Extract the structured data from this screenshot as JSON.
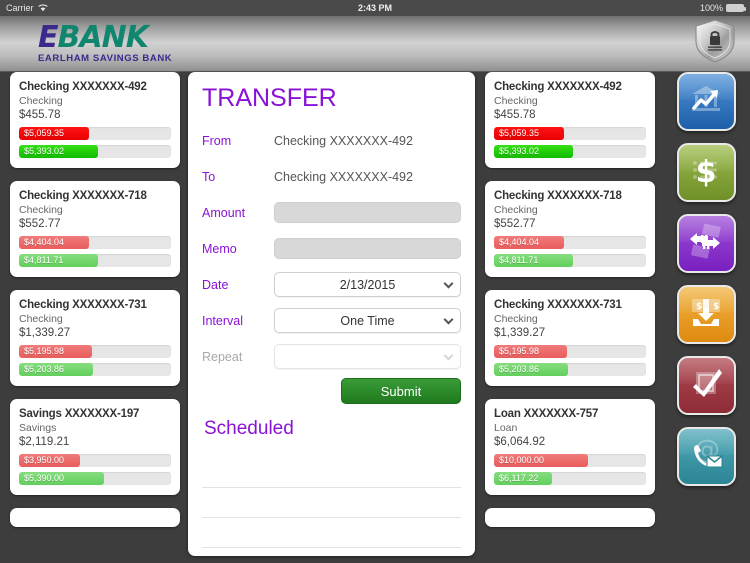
{
  "status_bar": {
    "carrier": "Carrier",
    "time": "2:43 PM",
    "battery": "100%",
    "wifi_icon": "wifi-icon",
    "battery_icon": "battery-icon"
  },
  "header": {
    "logo_e": "E",
    "logo_bank": "BANK",
    "logo_sub": "EARLHAM SAVINGS BANK",
    "shield_icon": "shield-lock-icon"
  },
  "colors": {
    "purple": "#8a12d6",
    "logo_indigo": "#3b2a8c",
    "logo_teal": "#11866f",
    "submit_green": "#1f7a1d",
    "bar_red": "#e85c5c",
    "bar_green": "#63cf5c",
    "bar_red_active": "#e80000",
    "bar_green_active": "#12bb00",
    "bar_track": "#e6e6e6"
  },
  "accounts_left": [
    {
      "title": "Checking XXXXXXX-492",
      "type": "Checking",
      "balance": "$455.78",
      "selected": true,
      "bars": [
        {
          "label": "$5,059.35",
          "color": "red",
          "pct": 46
        },
        {
          "label": "$5,393.02",
          "color": "green",
          "pct": 52
        }
      ]
    },
    {
      "title": "Checking XXXXXXX-718",
      "type": "Checking",
      "balance": "$552.77",
      "selected": false,
      "bars": [
        {
          "label": "$4,404.04",
          "color": "red",
          "pct": 46
        },
        {
          "label": "$4,811.71",
          "color": "green",
          "pct": 52
        }
      ]
    },
    {
      "title": "Checking XXXXXXX-731",
      "type": "Checking",
      "balance": "$1,339.27",
      "selected": false,
      "bars": [
        {
          "label": "$5,195.98",
          "color": "red",
          "pct": 48
        },
        {
          "label": "$5,203.86",
          "color": "green",
          "pct": 49
        }
      ]
    },
    {
      "title": "Savings XXXXXXX-197",
      "type": "Savings",
      "balance": "$2,119.21",
      "selected": false,
      "bars": [
        {
          "label": "$3,950.00",
          "color": "red",
          "pct": 40
        },
        {
          "label": "$5,390.00",
          "color": "green",
          "pct": 56
        }
      ]
    }
  ],
  "accounts_right": [
    {
      "title": "Checking XXXXXXX-492",
      "type": "Checking",
      "balance": "$455.78",
      "selected": true,
      "bars": [
        {
          "label": "$5,059.35",
          "color": "red",
          "pct": 46
        },
        {
          "label": "$5,393.02",
          "color": "green",
          "pct": 52
        }
      ]
    },
    {
      "title": "Checking XXXXXXX-718",
      "type": "Checking",
      "balance": "$552.77",
      "selected": false,
      "bars": [
        {
          "label": "$4,404.04",
          "color": "red",
          "pct": 46
        },
        {
          "label": "$4,811.71",
          "color": "green",
          "pct": 52
        }
      ]
    },
    {
      "title": "Checking XXXXXXX-731",
      "type": "Checking",
      "balance": "$1,339.27",
      "selected": false,
      "bars": [
        {
          "label": "$5,195.98",
          "color": "red",
          "pct": 48
        },
        {
          "label": "$5,203.86",
          "color": "green",
          "pct": 49
        }
      ]
    },
    {
      "title": "Loan XXXXXXX-757",
      "type": "Loan",
      "balance": "$6,064.92",
      "selected": false,
      "bars": [
        {
          "label": "$10,000.00",
          "color": "red",
          "pct": 62
        },
        {
          "label": "$6,117.22",
          "color": "green",
          "pct": 38
        }
      ]
    }
  ],
  "transfer": {
    "title": "TRANSFER",
    "from_label": "From",
    "from_value": "Checking XXXXXXX-492",
    "to_label": "To",
    "to_value": "Checking XXXXXXX-492",
    "amount_label": "Amount",
    "amount_value": "",
    "memo_label": "Memo",
    "memo_value": "",
    "date_label": "Date",
    "date_value": "2/13/2015",
    "interval_label": "Interval",
    "interval_value": "One Time",
    "repeat_label": "Repeat",
    "repeat_value": "",
    "submit_label": "Submit",
    "scheduled_title": "Scheduled",
    "scheduled_rows": [
      "",
      "",
      ""
    ]
  },
  "rail": [
    {
      "name": "accounts-chart-button",
      "icon": "bank-chart-icon",
      "color": "blue"
    },
    {
      "name": "payments-button",
      "icon": "dollar-icon",
      "color": "green"
    },
    {
      "name": "transfer-button",
      "icon": "transfer-arrows-icon",
      "color": "purple"
    },
    {
      "name": "deposit-button",
      "icon": "deposit-icon",
      "color": "orange"
    },
    {
      "name": "approvals-button",
      "icon": "checkmark-icon",
      "color": "red"
    },
    {
      "name": "contact-button",
      "icon": "contact-mail-icon",
      "color": "teal"
    }
  ]
}
